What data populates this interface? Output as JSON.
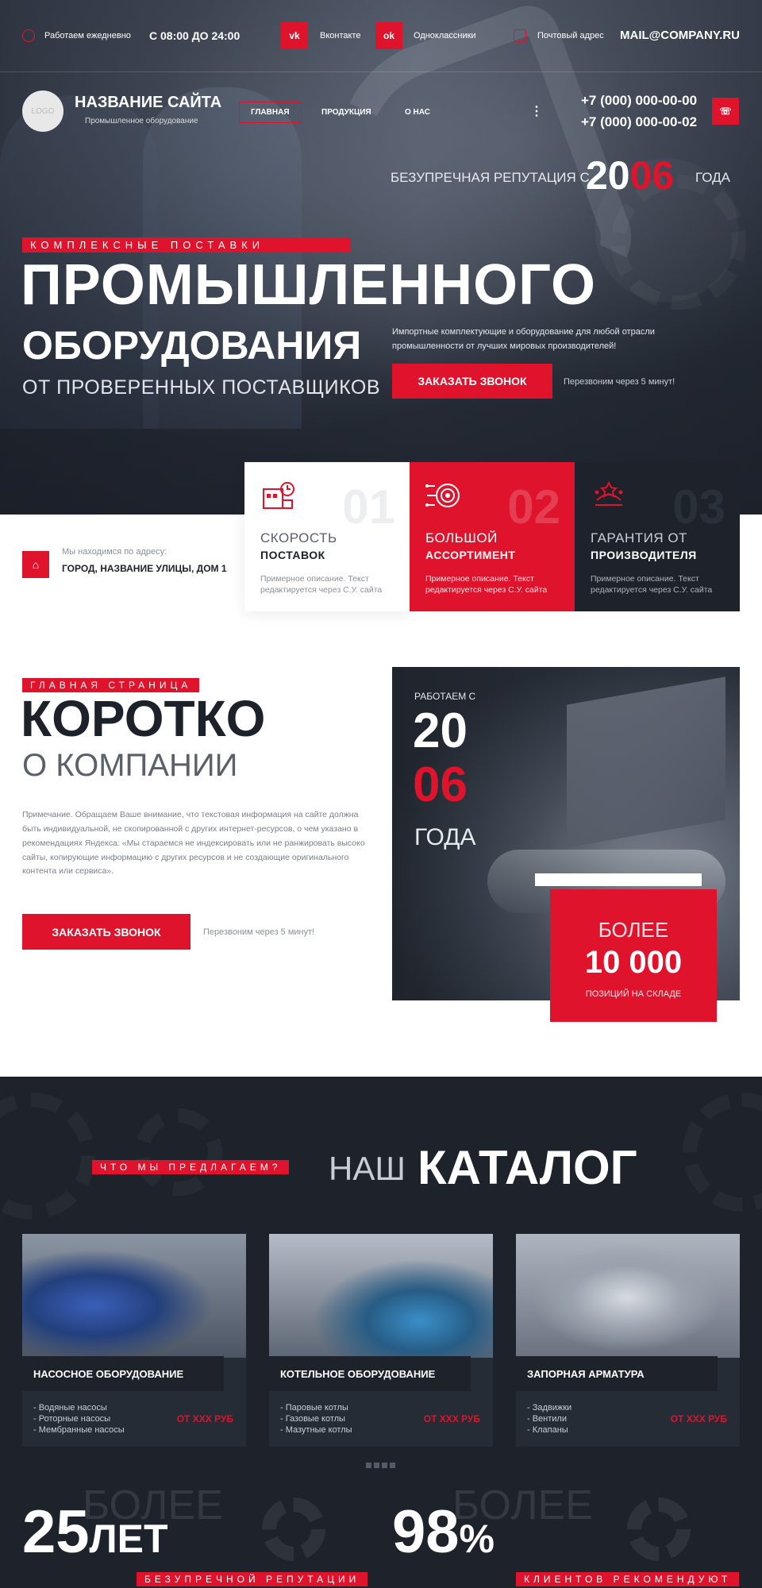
{
  "topbar": {
    "work_label": "Работаем ежедневно",
    "hours": "С 08:00 ДО 24:00",
    "vk_icon": "vk-icon",
    "vk_label": "Вконтакте",
    "ok_icon": "odnoklassniki-icon",
    "ok_label": "Одноклассники",
    "mail_label": "Почтовый адрес",
    "email": "MAIL@COMPANY.RU"
  },
  "header": {
    "logo": "LOGO",
    "site_name": "НАЗВАНИЕ САЙТА",
    "site_sub": "Промышленное оборудование",
    "nav": [
      "ГЛАВНАЯ",
      "ПРОДУКЦИЯ",
      "О НАС"
    ],
    "more": "⋮",
    "phone1": "+7 (000) 000-00-00",
    "phone2": "+7 (000) 000-00-02"
  },
  "hero": {
    "reputation_pre": "БЕЗУПРЕЧНАЯ РЕПУТАЦИЯ С",
    "year_a": "20",
    "year_b": "06",
    "reputation_post": "ГОДА",
    "tag": "КОМПЛЕКСНЫЕ ПОСТАВКИ",
    "title1": "ПРОМЫШЛЕННОГО",
    "title2": "ОБОРУДОВАНИЯ",
    "title3": "ОТ ПРОВЕРЕННЫХ ПОСТАВЩИКОВ",
    "desc": "Импортные комплектующие и оборудование для любой отрасли промышленности от лучших мировых производителей!",
    "button": "ЗАКАЗАТЬ ЗВОНОК",
    "callback_note": "Перезвоним через 5 минут!"
  },
  "address": {
    "label": "Мы находимся по адресу:",
    "value": "ГОРОД, НАЗВАНИЕ УЛИЦЫ, ДОМ 1"
  },
  "features": [
    {
      "num": "01",
      "t1": "СКОРОСТЬ",
      "t2": "ПОСТАВОК",
      "desc": "Примерное описание. Текст редактируется через С.У. сайта"
    },
    {
      "num": "02",
      "t1": "БОЛЬШОЙ",
      "t2": "АССОРТИМЕНТ",
      "desc": "Примерное описание. Текст редактируется через С.У. сайта"
    },
    {
      "num": "03",
      "t1": "ГАРАНТИЯ ОТ",
      "t2": "ПРОИЗВОДИТЕЛЯ",
      "desc": "Примерное описание. Текст редактируется через С.У. сайта"
    }
  ],
  "about": {
    "tag": "ГЛАВНАЯ СТРАНИЦА",
    "title": "КОРОТКО",
    "subtitle": "О КОМПАНИИ",
    "text": "Примечание. Обращаем Ваше внимание, что текстовая информация на сайте должна быть индивидуальной, не скопированной с других интернет-ресурсов, о чем указано в рекомендациях Яндекса: «Мы стараемся не индексировать или не ранжировать высоко сайты, копирующие информацию с других ресурсов и не создающие оригинального контента или сервиса».",
    "button": "ЗАКАЗАТЬ ЗВОНОК",
    "callback_note": "Перезвоним через 5 минут!",
    "since_label": "РАБОТАЕМ С",
    "since_a": "20",
    "since_b": "06",
    "since_post": "ГОДА",
    "stock_pre": "БОЛЕЕ",
    "stock_num": "10 000",
    "stock_label": "ПОЗИЦИЙ НА СКЛАДЕ"
  },
  "catalog": {
    "tag": "ЧТО МЫ ПРЕДЛАГАЕМ?",
    "title_light": "НАШ",
    "title_bold": "КАТАЛОГ",
    "cards": [
      {
        "title": "НАСОСНОЕ ОБОРУДОВАНИЕ",
        "items": [
          "- Водяные насосы",
          "- Роторные насосы",
          "- Мембранные насосы"
        ],
        "price": "ОТ XXX РУБ"
      },
      {
        "title": "КОТЕЛЬНОЕ ОБОРУДОВАНИЕ",
        "items": [
          "- Паровые котлы",
          "- Газовые котлы",
          "- Мазутные котлы"
        ],
        "price": "ОТ XXX РУБ"
      },
      {
        "title": "ЗАПОРНАЯ АРМАТУРА",
        "items": [
          "- Задвижки",
          "- Вентили",
          "- Клапаны"
        ],
        "price": "ОТ XXX РУБ"
      }
    ]
  },
  "stats": [
    {
      "bg": "БОЛЕЕ",
      "num": "25",
      "unit": "ЛЕТ",
      "tag": "БЕЗУПРЕЧНОЙ РЕПУТАЦИИ"
    },
    {
      "bg": "БОЛЕЕ",
      "num": "98",
      "unit": "%",
      "tag": "КЛИЕНТОВ РЕКОМЕНДУЮТ"
    }
  ],
  "colors": {
    "accent": "#e0132d",
    "dark": "#1d222b",
    "card": "#262c36"
  }
}
